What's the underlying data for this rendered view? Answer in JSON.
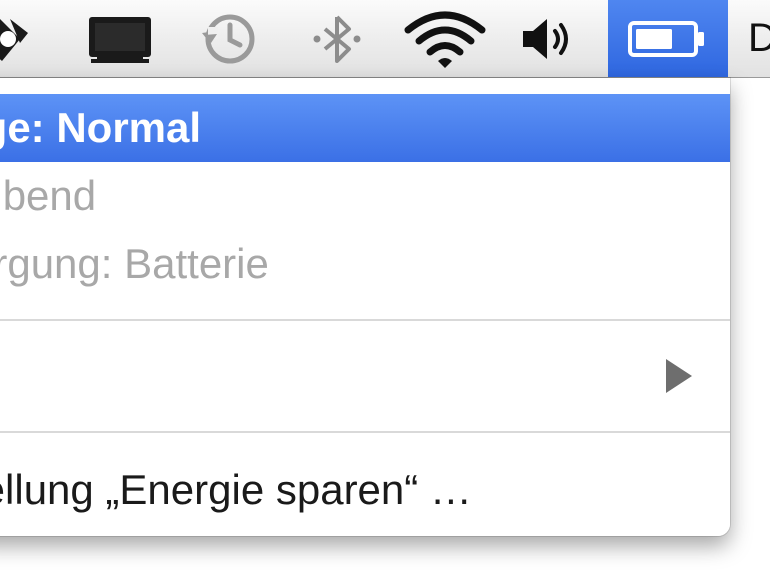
{
  "menubar": {
    "icons": [
      {
        "name": "growl-icon"
      },
      {
        "name": "display-icon"
      },
      {
        "name": "time-machine-icon"
      },
      {
        "name": "bluetooth-icon"
      },
      {
        "name": "wifi-icon"
      },
      {
        "name": "volume-icon"
      },
      {
        "name": "battery-icon",
        "active": true
      }
    ],
    "clock_label": "D"
  },
  "battery_menu": {
    "items": [
      {
        "label": "ige: Normal",
        "state": "highlighted"
      },
      {
        "label": "eibend",
        "state": "disabled"
      },
      {
        "label": "orgung: Batterie",
        "state": "disabled"
      },
      {
        "label": "",
        "state": "submenu"
      },
      {
        "label": "tellung „Energie sparen“ …",
        "state": "enabled"
      }
    ]
  },
  "colors": {
    "highlight": "#3b70e6",
    "disabled_text": "#a8a8a8",
    "menu_bg": "#ffffff"
  }
}
